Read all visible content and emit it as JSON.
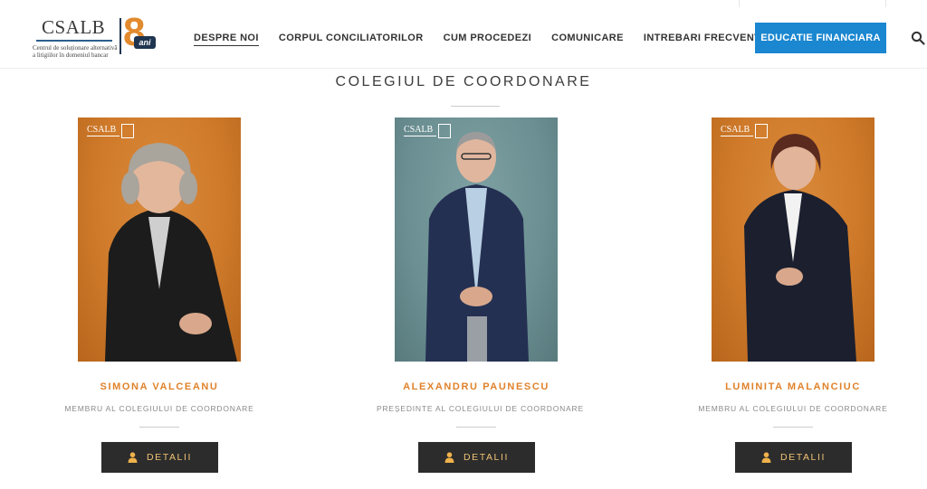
{
  "header": {
    "logo": {
      "brand": "CSALB",
      "tagline_1": "Centrul de soluționare alternativă",
      "tagline_2": "a litigiilor în domeniul bancar",
      "badge_number": "8",
      "badge_label": "ani"
    },
    "nav": [
      {
        "label": "DESPRE NOI",
        "active": true
      },
      {
        "label": "CORPUL CONCILIATORILOR",
        "active": false
      },
      {
        "label": "CUM PROCEDEZI",
        "active": false
      },
      {
        "label": "COMUNICARE",
        "active": false
      },
      {
        "label": "INTREBARI FRECVENTE",
        "active": false
      }
    ],
    "cta_label": "EDUCATIE FINANCIARA",
    "search_icon": "search-icon",
    "colors": {
      "cta": "#1a87d0",
      "accent": "#e0822b"
    }
  },
  "main": {
    "section_title": "COLEGIUL DE COORDONARE",
    "members": [
      {
        "name": "SIMONA VALCEANU",
        "role": "MEMBRU AL COLEGIULUI DE COORDONARE",
        "button": "DETALII",
        "photo_bg": "orange"
      },
      {
        "name": "ALEXANDRU PAUNESCU",
        "role": "PREȘEDINTE AL COLEGIULUI DE COORDONARE",
        "button": "DETALII",
        "photo_bg": "teal"
      },
      {
        "name": "LUMINITA MALANCIUC",
        "role": "MEMBRU AL COLEGIULUI DE COORDONARE",
        "button": "DETALII",
        "photo_bg": "orange"
      }
    ]
  }
}
